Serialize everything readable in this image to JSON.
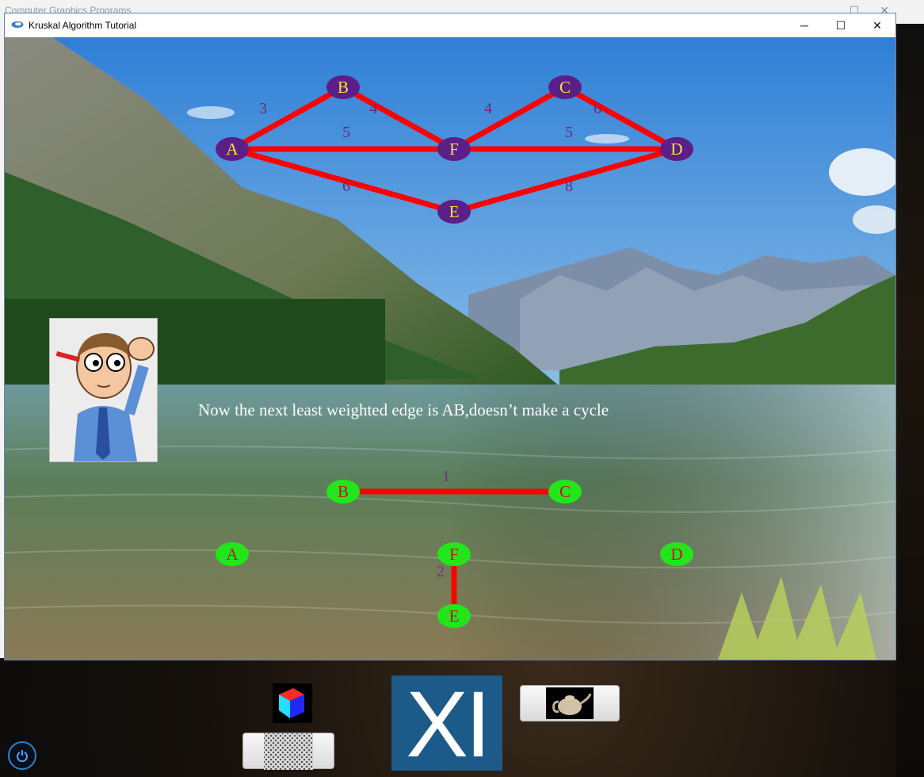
{
  "background_window": {
    "title": "Computer Graphics Programs"
  },
  "window": {
    "title": "Kruskal Algorithm Tutorial",
    "controls": {
      "minimize": "─",
      "maximize": "☐",
      "close": "✕"
    }
  },
  "top_graph": {
    "nodes": [
      {
        "id": "A",
        "label": "A"
      },
      {
        "id": "B",
        "label": "B"
      },
      {
        "id": "C",
        "label": "C"
      },
      {
        "id": "D",
        "label": "D"
      },
      {
        "id": "E",
        "label": "E"
      },
      {
        "id": "F",
        "label": "F"
      }
    ],
    "edges": [
      {
        "from": "A",
        "to": "B",
        "weight": "3"
      },
      {
        "from": "B",
        "to": "F",
        "weight": "4"
      },
      {
        "from": "F",
        "to": "C",
        "weight": "4"
      },
      {
        "from": "C",
        "to": "D",
        "weight": "6"
      },
      {
        "from": "A",
        "to": "F",
        "weight": "5"
      },
      {
        "from": "F",
        "to": "D",
        "weight": "5"
      },
      {
        "from": "A",
        "to": "E",
        "weight": "6"
      },
      {
        "from": "E",
        "to": "D",
        "weight": "8"
      }
    ],
    "node_color": "#5b1f87",
    "label_color": "#f5e04a",
    "edge_color": "#ff0000",
    "weight_color": "#6a2a7a"
  },
  "caption": "Now the next least weighted edge is AB,doesn’t make a cycle",
  "mst_graph": {
    "nodes": [
      {
        "id": "A",
        "label": "A"
      },
      {
        "id": "B",
        "label": "B"
      },
      {
        "id": "C",
        "label": "C"
      },
      {
        "id": "D",
        "label": "D"
      },
      {
        "id": "E",
        "label": "E"
      },
      {
        "id": "F",
        "label": "F"
      }
    ],
    "edges": [
      {
        "from": "B",
        "to": "C",
        "weight": "1"
      },
      {
        "from": "F",
        "to": "E",
        "weight": "2"
      }
    ],
    "node_color": "#22e61a",
    "label_color": "#c8102e",
    "edge_color": "#ff0000",
    "weight_color": "#7a2a8a"
  },
  "desktop": {
    "xi_label": "XI",
    "power_icon": "power-icon",
    "tiles": [
      "cube-icon",
      "mesh-icon",
      "xi-logo",
      "teapot-icon"
    ]
  }
}
